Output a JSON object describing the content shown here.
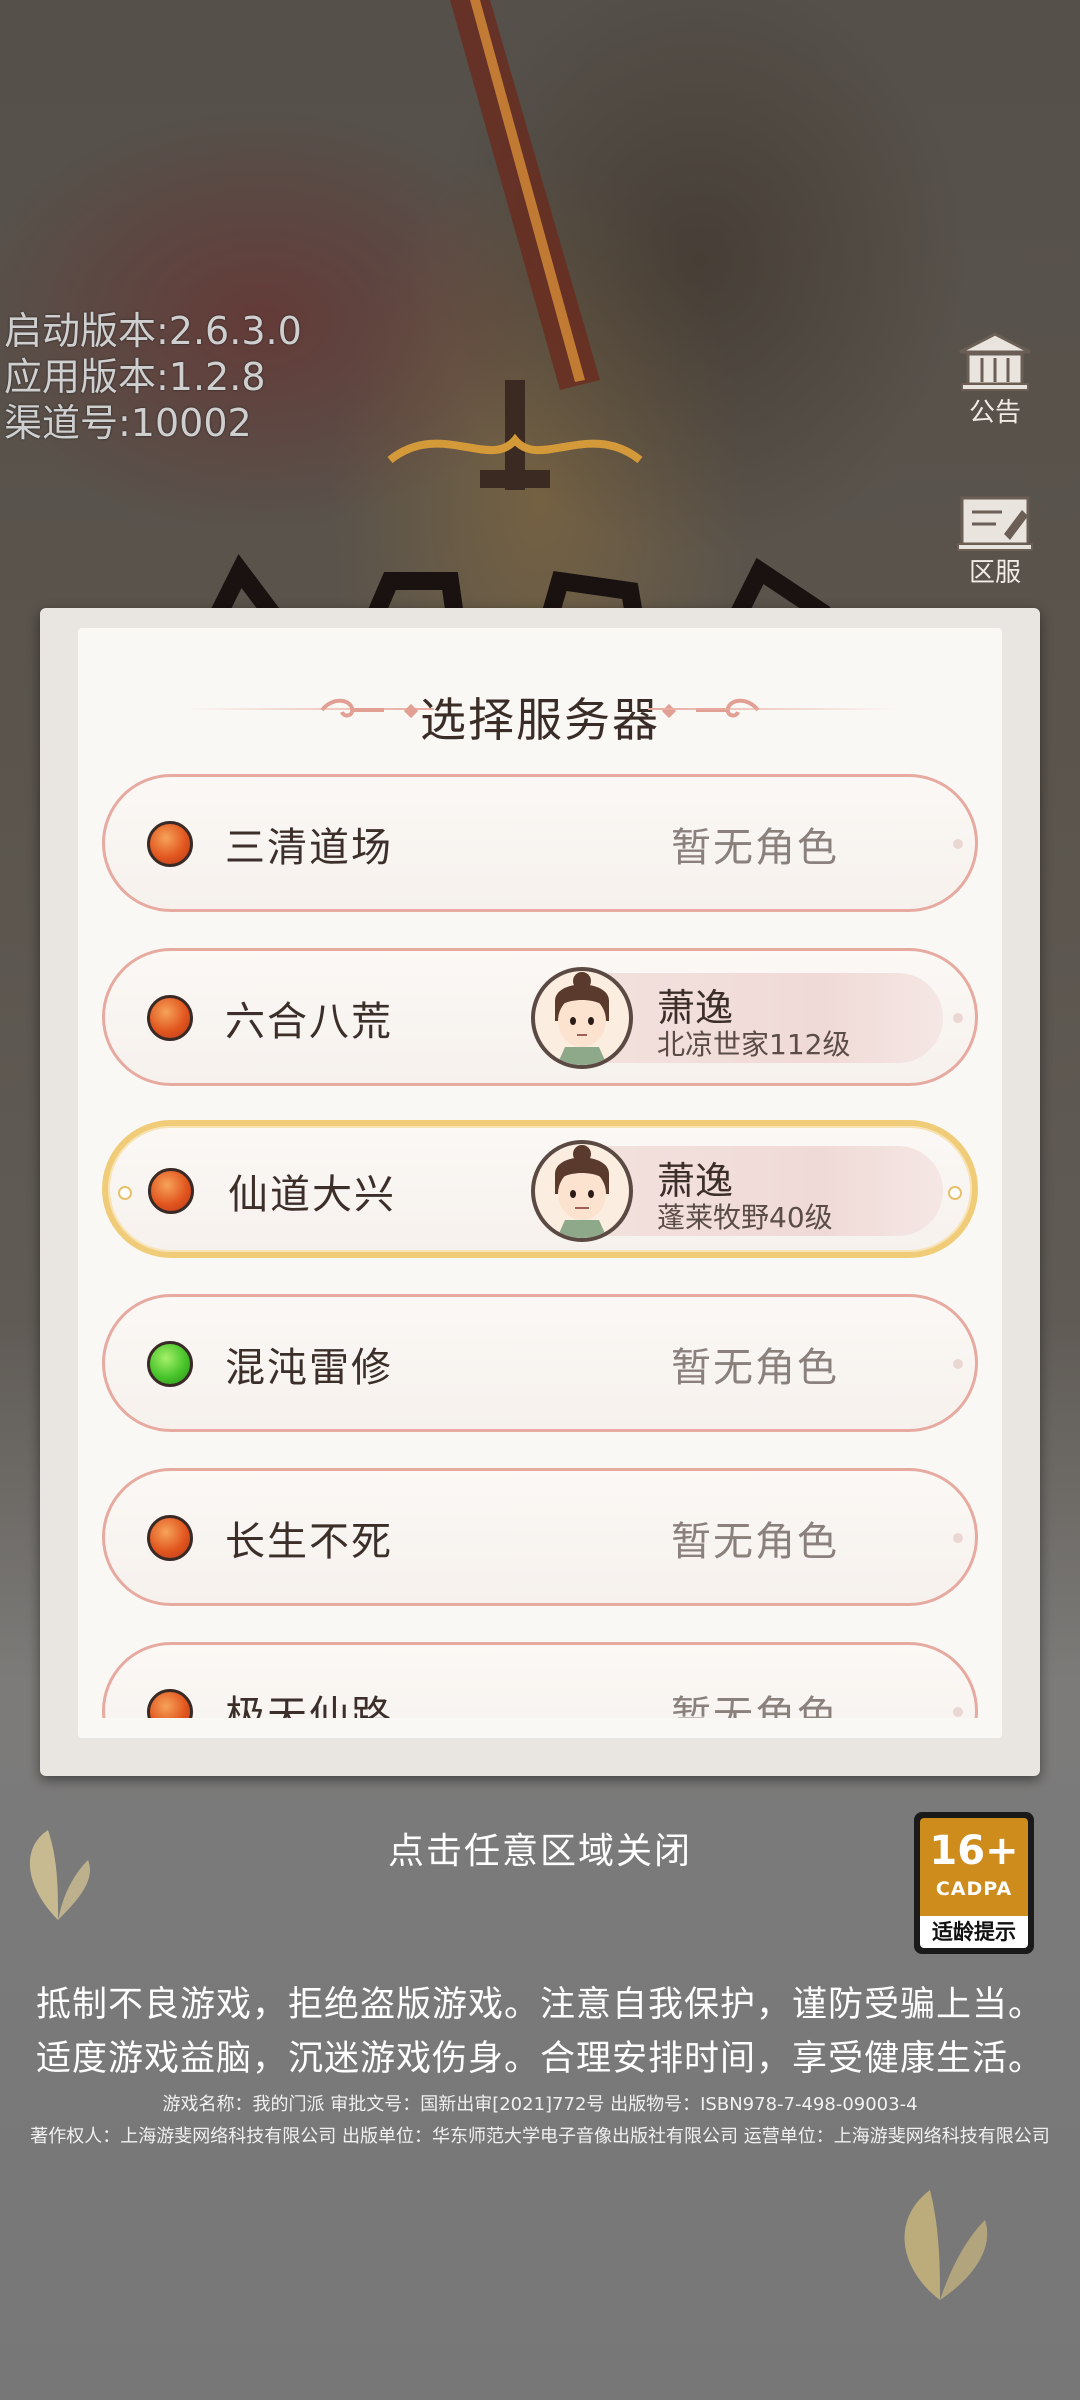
{
  "version_info": {
    "launcher_version": "启动版本:2.6.3.0",
    "app_version": "应用版本:1.2.8",
    "channel": "渠道号:10002"
  },
  "side_buttons": {
    "notice_label": "公告",
    "region_label": "区服"
  },
  "dialog": {
    "title": "选择服务器",
    "servers": [
      {
        "name": "三清道场",
        "status": "red",
        "role_text": "暂无角色"
      },
      {
        "name": "六合八荒",
        "status": "red",
        "character_name": "萧逸",
        "character_info": "北凉世家112级"
      },
      {
        "name": "仙道大兴",
        "status": "red",
        "selected": true,
        "character_name": "萧逸",
        "character_info": "蓬莱牧野40级"
      },
      {
        "name": "混沌雷修",
        "status": "green",
        "role_text": "暂无角色"
      },
      {
        "name": "长生不死",
        "status": "red",
        "role_text": "暂无角色"
      },
      {
        "name": "极天仙路",
        "status": "red",
        "role_text": "暂无角色"
      }
    ]
  },
  "close_hint": "点击任意区域关闭",
  "age_rating": {
    "age": "16+",
    "org": "CADPA",
    "label": "适龄提示"
  },
  "health_notice": {
    "line1": "抵制不良游戏，拒绝盗版游戏。注意自我保护，谨防受骗上当。",
    "line2": "适度游戏益脑，沉迷游戏伤身。合理安排时间，享受健康生活。"
  },
  "legal": {
    "game_info": "游戏名称：我的门派 审批文号：国新出审[2021]772号 出版物号：ISBN978-7-498-09003-4",
    "copyright_info": "著作权人：上海游斐网络科技有限公司 出版单位：华东师范大学电子音像出版社有限公司 运营单位：上海游斐网络科技有限公司"
  },
  "colors": {
    "dot_red": "#e2571f",
    "dot_green": "#48c42a",
    "row_border": "#e6aaa0",
    "selected_border": "#f0cc78",
    "age_badge": "#ce8c1c"
  }
}
